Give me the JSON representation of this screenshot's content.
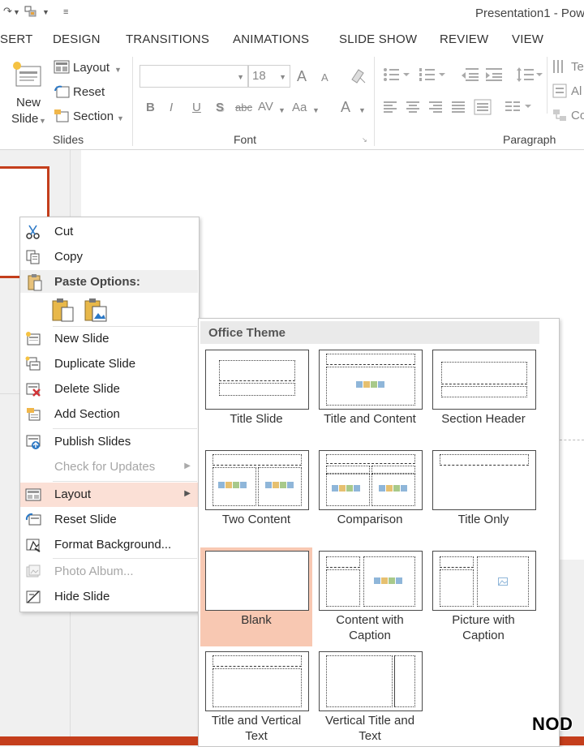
{
  "window": {
    "title": "Presentation1 - Pow"
  },
  "ribbon_tabs": {
    "insert": "SERT",
    "design": "DESIGN",
    "transitions": "TRANSITIONS",
    "animations": "ANIMATIONS",
    "slideshow": "SLIDE SHOW",
    "review": "REVIEW",
    "view": "VIEW"
  },
  "ribbon": {
    "slides_group": {
      "label": "Slides",
      "new_slide_line1": "New",
      "new_slide_line2": "Slide",
      "layout": "Layout",
      "reset": "Reset",
      "section": "Section"
    },
    "font_group": {
      "label": "Font",
      "font_size": "18",
      "bold": "B",
      "italic": "I",
      "underline": "U",
      "shadow": "S",
      "strikethrough": "abc",
      "spacing": "AV",
      "change_case": "Aa",
      "font_color": "A",
      "grow": "A",
      "shrink": "A"
    },
    "paragraph_group": {
      "label": "Paragraph"
    },
    "drawing_group": {
      "text_direction": "Te",
      "align_text": "Al",
      "convert": "Co"
    }
  },
  "context_menu": {
    "cut": "Cut",
    "copy": "Copy",
    "paste_options": "Paste Options:",
    "new_slide": "New Slide",
    "duplicate_slide": "Duplicate Slide",
    "delete_slide": "Delete Slide",
    "add_section": "Add Section",
    "publish_slides": "Publish Slides",
    "check_updates": "Check for Updates",
    "layout": "Layout",
    "reset_slide": "Reset Slide",
    "format_background": "Format Background...",
    "photo_album": "Photo Album...",
    "hide_slide": "Hide Slide"
  },
  "layout_gallery": {
    "header": "Office Theme",
    "selected": "Blank",
    "layouts": [
      {
        "line1": "Title Slide",
        "line2": ""
      },
      {
        "line1": "Title and Content",
        "line2": ""
      },
      {
        "line1": "Section Header",
        "line2": ""
      },
      {
        "line1": "Two Content",
        "line2": ""
      },
      {
        "line1": "Comparison",
        "line2": ""
      },
      {
        "line1": "Title Only",
        "line2": ""
      },
      {
        "line1": "Blank",
        "line2": ""
      },
      {
        "line1": "Content with",
        "line2": "Caption"
      },
      {
        "line1": "Picture with",
        "line2": "Caption"
      },
      {
        "line1": "Title and Vertical",
        "line2": "Text"
      },
      {
        "line1": "Vertical Title and",
        "line2": "Text"
      }
    ]
  },
  "watermark": "NOD",
  "colors": {
    "accent": "#c43e1c",
    "highlight": "#fbe0d6",
    "selected_layout": "#f8c8b2"
  }
}
